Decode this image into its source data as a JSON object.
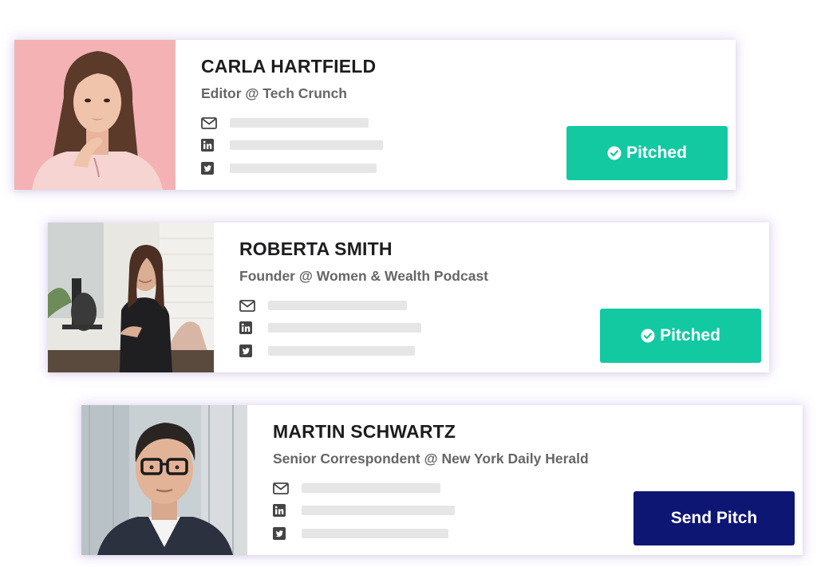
{
  "colors": {
    "pitched_bg": "#12c9a2",
    "send_bg": "#0d1673",
    "card_glow": "#c9b6ee",
    "placeholder_bar": "#e6e6e6"
  },
  "cards": [
    {
      "name": "CARLA HARTFIELD",
      "role": "Editor @ Tech Crunch",
      "contacts": [
        "mail-icon",
        "linkedin-icon",
        "twitter-icon"
      ],
      "action": {
        "label": "Pitched",
        "state": "pitched",
        "icon": "check-circle-icon"
      },
      "photo": "portrait-woman-pink-background"
    },
    {
      "name": "ROBERTA SMITH",
      "role": "Founder @ Women & Wealth Podcast",
      "contacts": [
        "mail-icon",
        "linkedin-icon",
        "twitter-icon"
      ],
      "action": {
        "label": "Pitched",
        "state": "pitched",
        "icon": "check-circle-icon"
      },
      "photo": "podcaster-with-microphone"
    },
    {
      "name": "MARTIN SCHWARTZ",
      "role": "Senior Correspondent @ New York Daily Herald",
      "contacts": [
        "mail-icon",
        "linkedin-icon",
        "twitter-icon"
      ],
      "action": {
        "label": "Send Pitch",
        "state": "send"
      },
      "photo": "portrait-man-glasses"
    }
  ]
}
